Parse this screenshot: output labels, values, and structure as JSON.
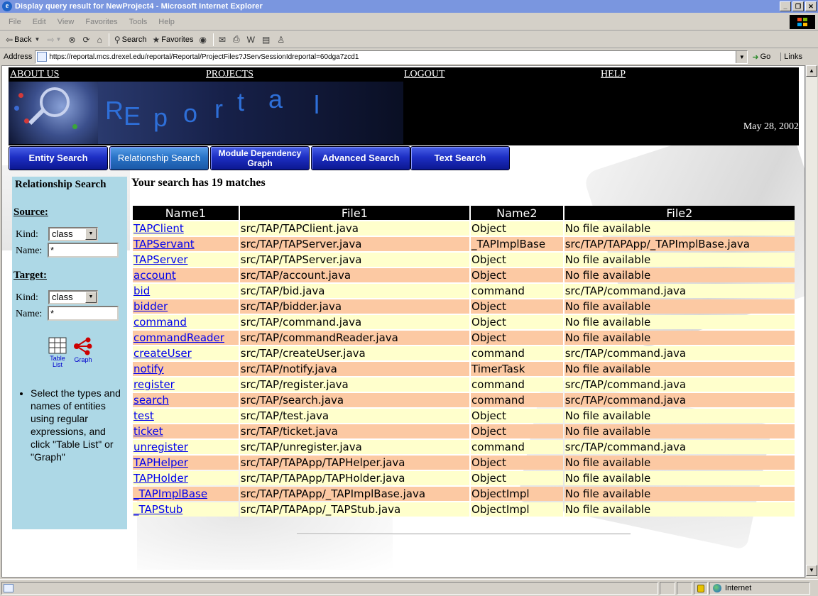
{
  "window": {
    "title": "Display query result for NewProject4 - Microsoft Internet Explorer",
    "buttons": [
      "_",
      "❐",
      "✕"
    ]
  },
  "menu": [
    "File",
    "Edit",
    "View",
    "Favorites",
    "Tools",
    "Help"
  ],
  "toolbar": {
    "back": "Back",
    "search": "Search",
    "favorites": "Favorites"
  },
  "address": {
    "label": "Address",
    "url": "https://reportal.mcs.drexel.edu/reportal/Reportal/ProjectFiles?JServSessionIdreportal=60dga7zcd1",
    "go": "Go",
    "links": "Links"
  },
  "nav": {
    "about": "ABOUT US",
    "projects": "PROJECTS",
    "logout": "LOGOUT",
    "help": "HELP"
  },
  "banner": {
    "letters": [
      "R",
      "E",
      "p",
      "o",
      "r",
      "t",
      "a",
      "l"
    ],
    "date": "May 28, 2002"
  },
  "tabs": [
    {
      "label": "Entity Search"
    },
    {
      "label": "Relationship Search"
    },
    {
      "label": "Module Dependency Graph"
    },
    {
      "label": "Advanced Search"
    },
    {
      "label": "Text Search"
    }
  ],
  "sidebar": {
    "title": "Relationship Search",
    "source": {
      "heading": "Source:",
      "kind_label": "Kind:",
      "kind_value": "class",
      "name_label": "Name:",
      "name_value": "*"
    },
    "target": {
      "heading": "Target:",
      "kind_label": "Kind:",
      "kind_value": "class",
      "name_label": "Name:",
      "name_value": "*"
    },
    "table_list_label": "Table List",
    "graph_label": "Graph",
    "help_text": "Select the types and names of entities using regular expressions, and click \"Table List\" or \"Graph\""
  },
  "results": {
    "summary": "Your search has 19 matches",
    "columns": [
      "Name1",
      "File1",
      "Name2",
      "File2"
    ],
    "rows": [
      [
        "TAPClient",
        "src/TAP/TAPClient.java",
        "Object",
        "No file available"
      ],
      [
        "TAPServant",
        "src/TAP/TAPServer.java",
        "_TAPImplBase",
        "src/TAP/TAPApp/_TAPImplBase.java"
      ],
      [
        "TAPServer",
        "src/TAP/TAPServer.java",
        "Object",
        "No file available"
      ],
      [
        "account",
        "src/TAP/account.java",
        "Object",
        "No file available"
      ],
      [
        "bid",
        "src/TAP/bid.java",
        "command",
        "src/TAP/command.java"
      ],
      [
        "bidder",
        "src/TAP/bidder.java",
        "Object",
        "No file available"
      ],
      [
        "command",
        "src/TAP/command.java",
        "Object",
        "No file available"
      ],
      [
        "commandReader",
        "src/TAP/commandReader.java",
        "Object",
        "No file available"
      ],
      [
        "createUser",
        "src/TAP/createUser.java",
        "command",
        "src/TAP/command.java"
      ],
      [
        "notify",
        "src/TAP/notify.java",
        "TimerTask",
        "No file available"
      ],
      [
        "register",
        "src/TAP/register.java",
        "command",
        "src/TAP/command.java"
      ],
      [
        "search",
        "src/TAP/search.java",
        "command",
        "src/TAP/command.java"
      ],
      [
        "test",
        "src/TAP/test.java",
        "Object",
        "No file available"
      ],
      [
        "ticket",
        "src/TAP/ticket.java",
        "Object",
        "No file available"
      ],
      [
        "unregister",
        "src/TAP/unregister.java",
        "command",
        "src/TAP/command.java"
      ],
      [
        "TAPHelper",
        "src/TAP/TAPApp/TAPHelper.java",
        "Object",
        "No file available"
      ],
      [
        "TAPHolder",
        "src/TAP/TAPApp/TAPHolder.java",
        "Object",
        "No file available"
      ],
      [
        "_TAPImplBase",
        "src/TAP/TAPApp/_TAPImplBase.java",
        "ObjectImpl",
        "No file available"
      ],
      [
        "_TAPStub",
        "src/TAP/TAPApp/_TAPStub.java",
        "ObjectImpl",
        "No file available"
      ]
    ]
  },
  "status": {
    "zone": "Internet"
  },
  "colors": {
    "row_light": "#ffffcc",
    "row_dark": "#fcc9a3",
    "sidebar_bg": "#add8e6",
    "tab_blue": "#1d2fc4",
    "link": "#0000ee"
  }
}
